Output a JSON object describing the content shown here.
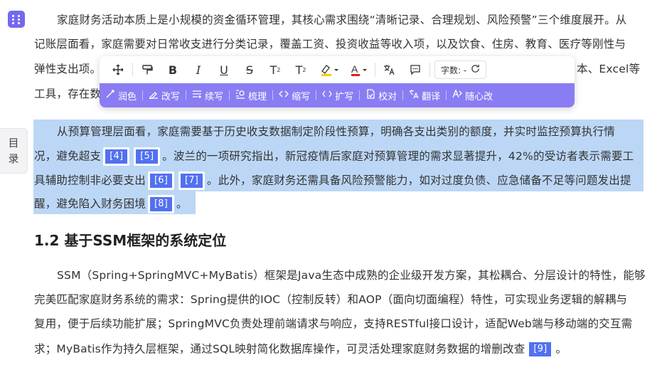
{
  "side": {
    "toc_label_1": "目",
    "toc_label_2": "录"
  },
  "para1": {
    "line1": "家庭财务活动本质上是小规模的资金循环管理，其核心需求围绕“清晰记录、合理规划、风险预警”三个维度展开。从",
    "line2": "记账层面看，家庭需要对日常收支进行分类记录，覆盖工资、投资收益等收入项，以及饮食、住房、教育、医疗等刚性与",
    "line3a": "弹性支出项。",
    "line3b": "本、Excel等",
    "line4a": "工具，存在数"
  },
  "para2": {
    "line1": "从预算管理层面看，家庭需要基于历史收支数据制定阶段性预算，明确各支出类别的额度，并实时监控预算执行情",
    "line2a": "况，避免超支",
    "line2b": "。波兰的一项研究指出，新冠疫情后家庭对预算管理的需求显著提升，42%的受访者表示需要工",
    "line3a": "具辅助控制非必要支出",
    "line3b": "。此外，家庭财务还需具备风险预警能力，如对过度负债、应急储备不足等问题发出提",
    "line4a": "醒，避免陷入财务困境",
    "line4b": "。"
  },
  "citations": {
    "c4": "[4]",
    "c5": "[5]",
    "c6": "[6]",
    "c7": "[7]",
    "c8": "[8]",
    "c9": "[9]"
  },
  "heading": "1.2 基于SSM框架的系统定位",
  "para3": {
    "line1": "SSM（Spring+SpringMVC+MyBatis）框架是Java生态中成熟的企业级开发方案，其松耦合、分层设计的特性，能够",
    "line2": "完美匹配家庭财务系统的需求：Spring提供的IOC（控制反转）和AOP（面向切面编程）特性，可实现业务逻辑的解耦与",
    "line3": "复用，便于后续功能扩展；SpringMVC负责处理前端请求与响应，支持RESTful接口设计，适配Web端与移动端的交互需",
    "line4a": "求；MyBatis作为持久层框架，通过SQL映射简化数据库操作，可灵活处理家庭财务数据的增删改查",
    "line4b": "。"
  },
  "toolbar": {
    "word_count_label": "字数: -",
    "ai_actions": [
      "润色",
      "改写",
      "续写",
      "梳理",
      "缩写",
      "扩写",
      "校对",
      "翻译",
      "随心改"
    ]
  },
  "icons": {
    "move": "move-icon",
    "brush": "format-brush-icon",
    "bold": "bold-icon",
    "italic": "italic-icon",
    "underline": "underline-icon",
    "strike": "strikethrough-icon",
    "sup": "superscript-icon",
    "sub": "subscript-icon",
    "highlight": "highlight-color-icon",
    "fontcolor": "font-color-icon",
    "translate": "translate-icon",
    "comment": "comment-icon",
    "refresh": "refresh-icon"
  },
  "colors": {
    "accent": "#7468f0",
    "toolbar_ai_bg": "#8a7df3",
    "selection": "#bcd7f6",
    "citation": "#5271f0"
  }
}
